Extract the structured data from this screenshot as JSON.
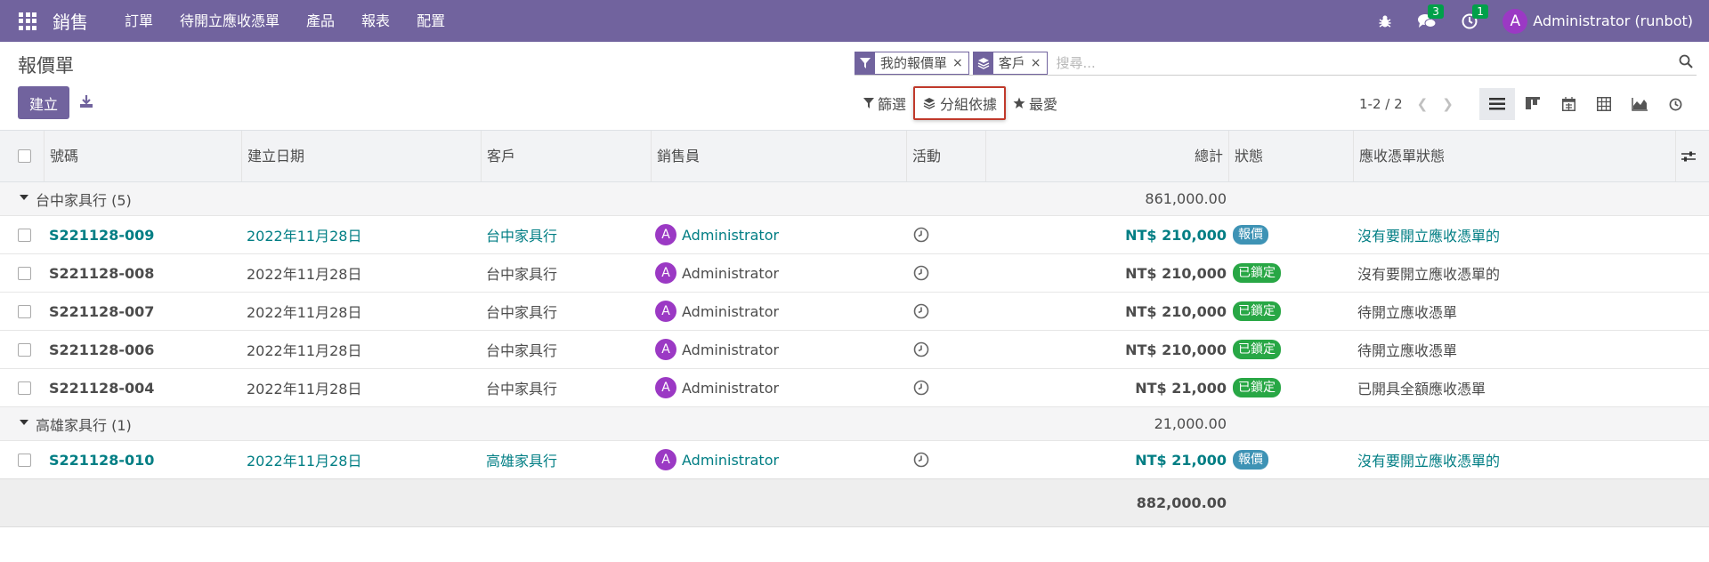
{
  "nav": {
    "brand": "銷售",
    "menu": [
      "訂單",
      "待開立應收憑單",
      "產品",
      "報表",
      "配置"
    ],
    "messages_count": "3",
    "activities_count": "1",
    "avatar_letter": "A",
    "user": "Administrator (runbot)"
  },
  "control": {
    "title": "報價單",
    "create_label": "建立",
    "facets": [
      "我的報價單",
      "客戶"
    ],
    "search_placeholder": "搜尋...",
    "filter_label": "篩選",
    "groupby_label": "分組依據",
    "favorites_label": "最愛",
    "pager": "1-2 / 2"
  },
  "columns": {
    "number": "號碼",
    "date": "建立日期",
    "customer": "客戶",
    "salesperson": "銷售員",
    "activity": "活動",
    "total": "總計",
    "state": "狀態",
    "invoice_status": "應收憑單狀態"
  },
  "groups": [
    {
      "label": "台中家具行 (5)",
      "total": "861,000.00",
      "rows": [
        {
          "number": "S221128-009",
          "date": "2022年11月28日",
          "customer": "台中家具行",
          "avatar": "A",
          "salesperson": "Administrator",
          "total": "NT$ 210,000",
          "state": "報價",
          "invoice_status": "沒有要開立應收憑單的"
        },
        {
          "number": "S221128-008",
          "date": "2022年11月28日",
          "customer": "台中家具行",
          "avatar": "A",
          "salesperson": "Administrator",
          "total": "NT$ 210,000",
          "state": "已鎖定",
          "invoice_status": "沒有要開立應收憑單的"
        },
        {
          "number": "S221128-007",
          "date": "2022年11月28日",
          "customer": "台中家具行",
          "avatar": "A",
          "salesperson": "Administrator",
          "total": "NT$ 210,000",
          "state": "已鎖定",
          "invoice_status": "待開立應收憑單"
        },
        {
          "number": "S221128-006",
          "date": "2022年11月28日",
          "customer": "台中家具行",
          "avatar": "A",
          "salesperson": "Administrator",
          "total": "NT$ 210,000",
          "state": "已鎖定",
          "invoice_status": "待開立應收憑單"
        },
        {
          "number": "S221128-004",
          "date": "2022年11月28日",
          "customer": "台中家具行",
          "avatar": "A",
          "salesperson": "Administrator",
          "total": "NT$ 21,000",
          "state": "已鎖定",
          "invoice_status": "已開具全額應收憑單"
        }
      ]
    },
    {
      "label": "高雄家具行 (1)",
      "total": "21,000.00",
      "rows": [
        {
          "number": "S221128-010",
          "date": "2022年11月28日",
          "customer": "高雄家具行",
          "avatar": "A",
          "salesperson": "Administrator",
          "total": "NT$ 21,000",
          "state": "報價",
          "invoice_status": "沒有要開立應收憑單的"
        }
      ]
    }
  ],
  "grand_total": "882,000.00",
  "colors": {
    "navbar": "#71639e",
    "link": "#017e84",
    "quotation_badge": "#3e93b5",
    "locked_badge": "#28a745",
    "avatar": "#9b39c4",
    "highlight_border": "#c0392b"
  }
}
